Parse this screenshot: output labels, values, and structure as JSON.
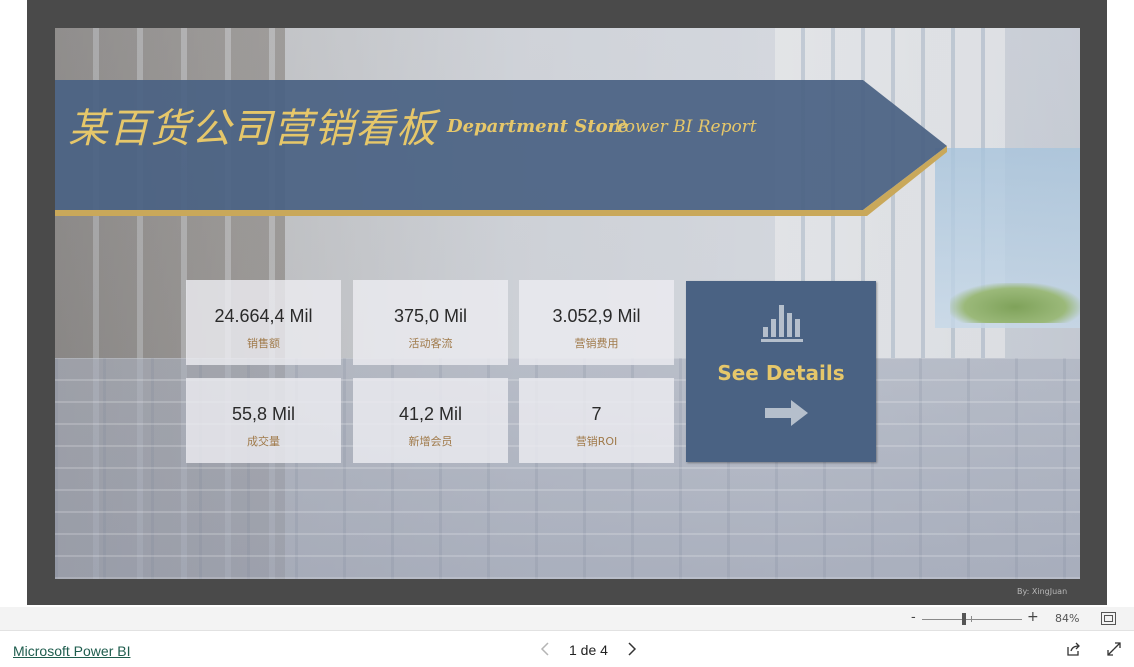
{
  "report": {
    "title_cn": "某百货公司营销看板",
    "title_en_bold": "Department Store",
    "title_en_rest": "Power BI Report",
    "author": "By: XingJuan",
    "colors": {
      "banner": "#4a6283",
      "gold": "#e6c76a",
      "frame": "#4a4a4a"
    }
  },
  "kpis": [
    {
      "value": "24.664,4 Mil",
      "label": "销售额"
    },
    {
      "value": "375,0 Mil",
      "label": "活动客流"
    },
    {
      "value": "3.052,9 Mil",
      "label": "营销费用"
    },
    {
      "value": "55,8 Mil",
      "label": "成交量"
    },
    {
      "value": "41,2 Mil",
      "label": "新增会员"
    },
    {
      "value": "7",
      "label": "营销ROI"
    }
  ],
  "details": {
    "label": "See Details",
    "icons": [
      "bar-chart-icon",
      "arrow-right-icon"
    ]
  },
  "zoom": {
    "minus": "-",
    "plus": "+",
    "level": "84%"
  },
  "footer": {
    "brand": "Microsoft Power BI",
    "page_indicator": "1 de 4"
  }
}
